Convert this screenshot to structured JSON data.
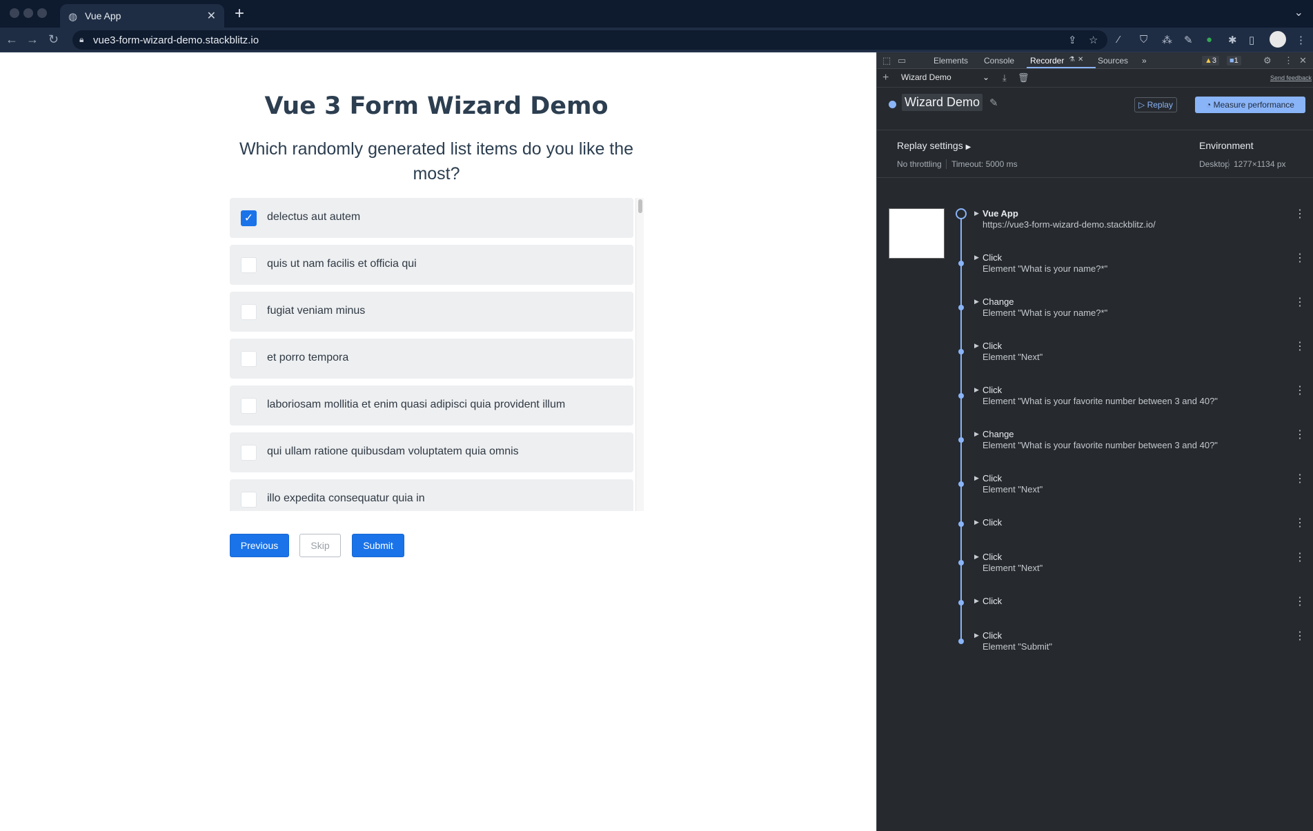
{
  "browser": {
    "tab_title": "Vue App",
    "url": "vue3-form-wizard-demo.stackblitz.io"
  },
  "page": {
    "title": "Vue 3 Form Wizard Demo",
    "question": "Which randomly generated list items do you like the most?",
    "items": [
      {
        "label": "delectus aut autem",
        "checked": true
      },
      {
        "label": "quis ut nam facilis et officia qui",
        "checked": false
      },
      {
        "label": "fugiat veniam minus",
        "checked": false
      },
      {
        "label": "et porro tempora",
        "checked": false
      },
      {
        "label": "laboriosam mollitia et enim quasi adipisci quia provident illum",
        "checked": false
      },
      {
        "label": "qui ullam ratione quibusdam voluptatem quia omnis",
        "checked": false
      },
      {
        "label": "illo expedita consequatur quia in",
        "checked": false
      }
    ],
    "buttons": {
      "previous": "Previous",
      "skip": "Skip",
      "submit": "Submit"
    }
  },
  "devtools": {
    "tabs": [
      "Elements",
      "Console",
      "Recorder",
      "Sources"
    ],
    "active_tab": "Recorder",
    "warnings": "3",
    "messages": "1",
    "recording_select": "Wizard Demo",
    "send_feedback": "Send feedback",
    "recording_title": "Wizard Demo",
    "replay_label": "Replay",
    "measure_label": "Measure performance",
    "replay_settings_label": "Replay settings",
    "throttling": "No throttling",
    "timeout": "Timeout: 5000 ms",
    "environment_label": "Environment",
    "env_device": "Desktop",
    "env_size": "1277×1134 px",
    "steps": [
      {
        "title": "Vue App",
        "detail": "https://vue3-form-wizard-demo.stackblitz.io/"
      },
      {
        "title": "Click",
        "detail": "Element \"What is your name?*\""
      },
      {
        "title": "Change",
        "detail": "Element \"What is your name?*\""
      },
      {
        "title": "Click",
        "detail": "Element \"Next\""
      },
      {
        "title": "Click",
        "detail": "Element \"What is your favorite number between 3 and 40?\""
      },
      {
        "title": "Change",
        "detail": "Element \"What is your favorite number between 3 and 40?\""
      },
      {
        "title": "Click",
        "detail": "Element \"Next\""
      },
      {
        "title": "Click",
        "detail": ""
      },
      {
        "title": "Click",
        "detail": "Element \"Next\""
      },
      {
        "title": "Click",
        "detail": ""
      },
      {
        "title": "Click",
        "detail": "Element \"Submit\""
      }
    ]
  },
  "colors": {
    "accent": "#1a73e8",
    "devtools_accent": "#8ab4f8"
  }
}
